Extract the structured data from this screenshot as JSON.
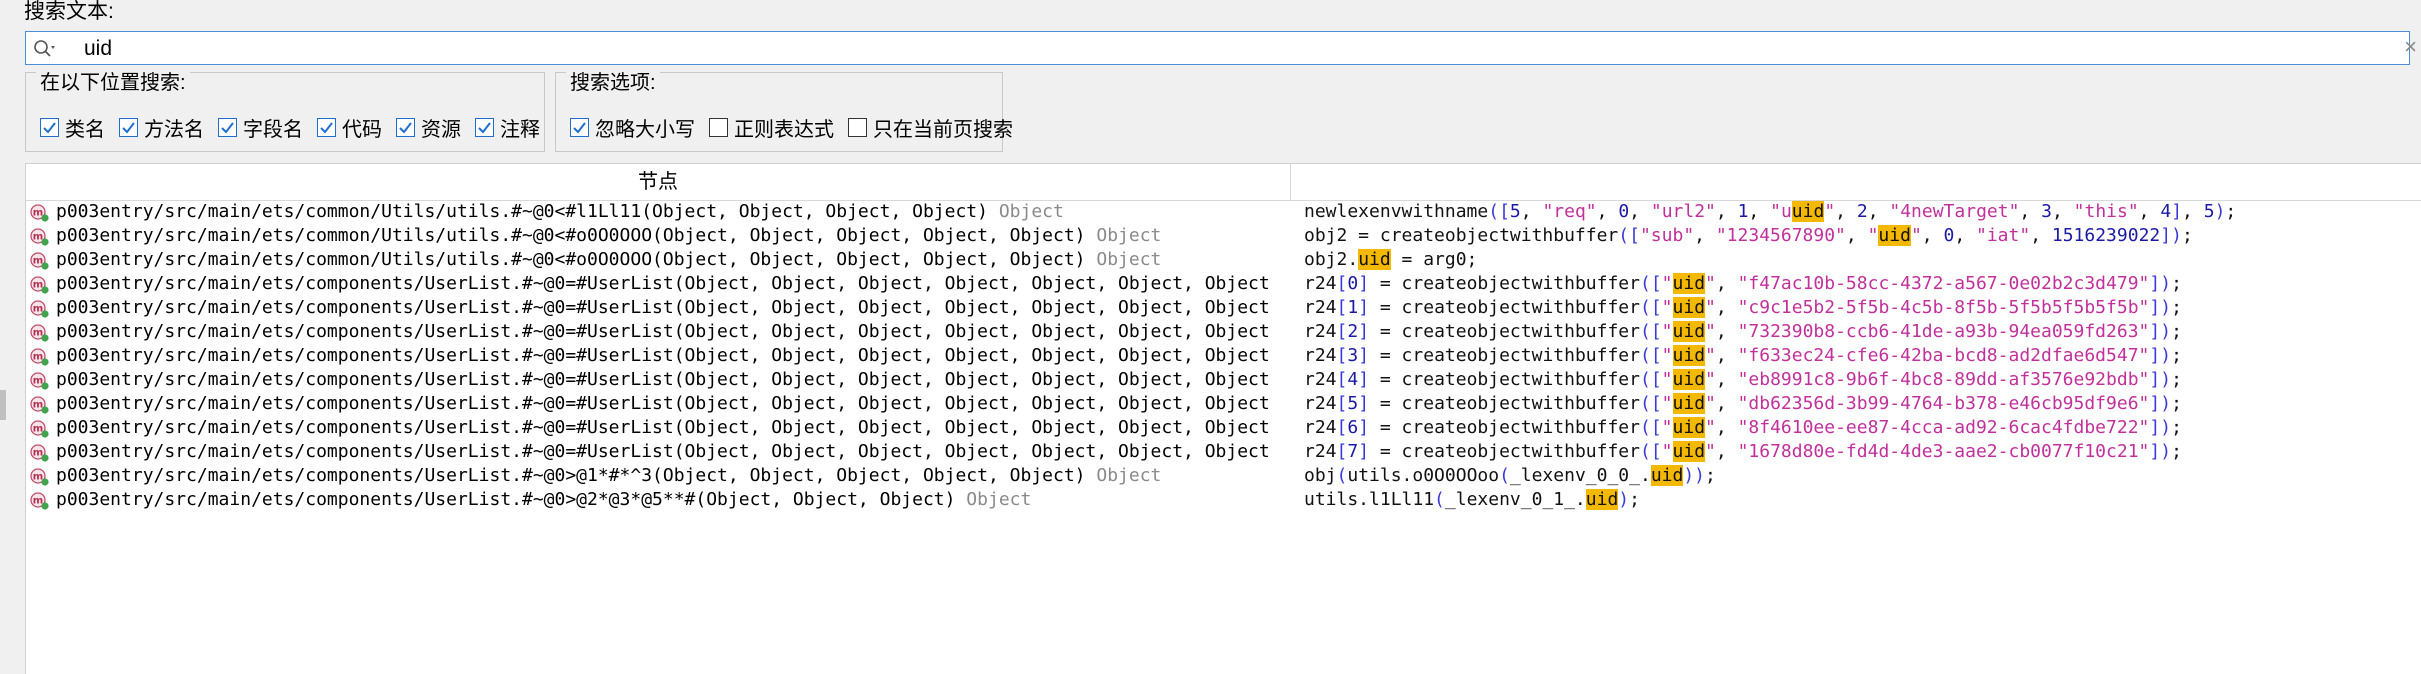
{
  "search_label": "搜索文本:",
  "search": {
    "value": "uid",
    "placeholder": ""
  },
  "location_group": {
    "legend": "在以下位置搜索:",
    "options": [
      {
        "label": "类名",
        "checked": true
      },
      {
        "label": "方法名",
        "checked": true
      },
      {
        "label": "字段名",
        "checked": true
      },
      {
        "label": "代码",
        "checked": true
      },
      {
        "label": "资源",
        "checked": true
      },
      {
        "label": "注释",
        "checked": true
      }
    ]
  },
  "options_group": {
    "legend": "搜索选项:",
    "options": [
      {
        "label": "忽略大小写",
        "checked": true
      },
      {
        "label": "正则表达式",
        "checked": false
      },
      {
        "label": "只在当前页搜索",
        "checked": false
      }
    ]
  },
  "table": {
    "header_node": "节点",
    "rows": [
      {
        "node": "p003entry/src/main/ets/common/Utils/utils.#~@0<#l1Ll11(Object, Object, Object, Object)",
        "type": "Object",
        "code": [
          [
            "t",
            "newlexenvwithname"
          ],
          [
            "b",
            "(["
          ],
          [
            "n",
            "5"
          ],
          [
            "t",
            ", "
          ],
          [
            "s",
            "\"req\""
          ],
          [
            "t",
            ", "
          ],
          [
            "n",
            "0"
          ],
          [
            "t",
            ", "
          ],
          [
            "s",
            "\"url2\""
          ],
          [
            "t",
            ", "
          ],
          [
            "n",
            "1"
          ],
          [
            "t",
            ", "
          ],
          [
            "s",
            "\"u"
          ],
          [
            "h",
            "uid"
          ],
          [
            "s",
            "\""
          ],
          [
            "t",
            ", "
          ],
          [
            "n",
            "2"
          ],
          [
            "t",
            ", "
          ],
          [
            "s",
            "\"4newTarget\""
          ],
          [
            "t",
            ", "
          ],
          [
            "n",
            "3"
          ],
          [
            "t",
            ", "
          ],
          [
            "s",
            "\"this\""
          ],
          [
            "t",
            ", "
          ],
          [
            "n",
            "4"
          ],
          [
            "b",
            "]"
          ],
          [
            "t",
            ", "
          ],
          [
            "n",
            "5"
          ],
          [
            "b",
            ")"
          ],
          [
            "t",
            ";"
          ]
        ]
      },
      {
        "node": "p003entry/src/main/ets/common/Utils/utils.#~@0<#o0O0OOO(Object, Object, Object, Object, Object)",
        "type": "Object",
        "code": [
          [
            "t",
            "obj2 = createobjectwithbuffer"
          ],
          [
            "b",
            "(["
          ],
          [
            "s",
            "\"sub\""
          ],
          [
            "t",
            ", "
          ],
          [
            "s",
            "\"1234567890\""
          ],
          [
            "t",
            ", "
          ],
          [
            "s",
            "\""
          ],
          [
            "h",
            "uid"
          ],
          [
            "s",
            "\""
          ],
          [
            "t",
            ", "
          ],
          [
            "n",
            "0"
          ],
          [
            "t",
            ", "
          ],
          [
            "s",
            "\"iat\""
          ],
          [
            "t",
            ", "
          ],
          [
            "n",
            "1516239022"
          ],
          [
            "b",
            "])"
          ],
          [
            "t",
            ";"
          ]
        ]
      },
      {
        "node": "p003entry/src/main/ets/common/Utils/utils.#~@0<#o0O0OOO(Object, Object, Object, Object, Object)",
        "type": "Object",
        "code": [
          [
            "t",
            "obj2."
          ],
          [
            "h",
            "uid"
          ],
          [
            "t",
            " = arg0;"
          ]
        ]
      },
      {
        "node": "p003entry/src/main/ets/components/UserList.#~@0=#UserList(Object, Object, Object, Object, Object, Object, Object",
        "type": "",
        "code": [
          [
            "t",
            "r24"
          ],
          [
            "b",
            "["
          ],
          [
            "n",
            "0"
          ],
          [
            "b",
            "]"
          ],
          [
            "t",
            " = createobjectwithbuffer"
          ],
          [
            "b",
            "(["
          ],
          [
            "s",
            "\""
          ],
          [
            "h",
            "uid"
          ],
          [
            "s",
            "\""
          ],
          [
            "t",
            ", "
          ],
          [
            "s",
            "\"f47ac10b-58cc-4372-a567-0e02b2c3d479\""
          ],
          [
            "b",
            "])"
          ],
          [
            "t",
            ";"
          ]
        ]
      },
      {
        "node": "p003entry/src/main/ets/components/UserList.#~@0=#UserList(Object, Object, Object, Object, Object, Object, Object",
        "type": "",
        "code": [
          [
            "t",
            "r24"
          ],
          [
            "b",
            "["
          ],
          [
            "n",
            "1"
          ],
          [
            "b",
            "]"
          ],
          [
            "t",
            " = createobjectwithbuffer"
          ],
          [
            "b",
            "(["
          ],
          [
            "s",
            "\""
          ],
          [
            "h",
            "uid"
          ],
          [
            "s",
            "\""
          ],
          [
            "t",
            ", "
          ],
          [
            "s",
            "\"c9c1e5b2-5f5b-4c5b-8f5b-5f5b5f5b5f5b\""
          ],
          [
            "b",
            "])"
          ],
          [
            "t",
            ";"
          ]
        ]
      },
      {
        "node": "p003entry/src/main/ets/components/UserList.#~@0=#UserList(Object, Object, Object, Object, Object, Object, Object",
        "type": "",
        "code": [
          [
            "t",
            "r24"
          ],
          [
            "b",
            "["
          ],
          [
            "n",
            "2"
          ],
          [
            "b",
            "]"
          ],
          [
            "t",
            " = createobjectwithbuffer"
          ],
          [
            "b",
            "(["
          ],
          [
            "s",
            "\""
          ],
          [
            "h",
            "uid"
          ],
          [
            "s",
            "\""
          ],
          [
            "t",
            ", "
          ],
          [
            "s",
            "\"732390b8-ccb6-41de-a93b-94ea059fd263\""
          ],
          [
            "b",
            "])"
          ],
          [
            "t",
            ";"
          ]
        ]
      },
      {
        "node": "p003entry/src/main/ets/components/UserList.#~@0=#UserList(Object, Object, Object, Object, Object, Object, Object",
        "type": "",
        "code": [
          [
            "t",
            "r24"
          ],
          [
            "b",
            "["
          ],
          [
            "n",
            "3"
          ],
          [
            "b",
            "]"
          ],
          [
            "t",
            " = createobjectwithbuffer"
          ],
          [
            "b",
            "(["
          ],
          [
            "s",
            "\""
          ],
          [
            "h",
            "uid"
          ],
          [
            "s",
            "\""
          ],
          [
            "t",
            ", "
          ],
          [
            "s",
            "\"f633ec24-cfe6-42ba-bcd8-ad2dfae6d547\""
          ],
          [
            "b",
            "])"
          ],
          [
            "t",
            ";"
          ]
        ]
      },
      {
        "node": "p003entry/src/main/ets/components/UserList.#~@0=#UserList(Object, Object, Object, Object, Object, Object, Object",
        "type": "",
        "code": [
          [
            "t",
            "r24"
          ],
          [
            "b",
            "["
          ],
          [
            "n",
            "4"
          ],
          [
            "b",
            "]"
          ],
          [
            "t",
            " = createobjectwithbuffer"
          ],
          [
            "b",
            "(["
          ],
          [
            "s",
            "\""
          ],
          [
            "h",
            "uid"
          ],
          [
            "s",
            "\""
          ],
          [
            "t",
            ", "
          ],
          [
            "s",
            "\"eb8991c8-9b6f-4bc8-89dd-af3576e92bdb\""
          ],
          [
            "b",
            "])"
          ],
          [
            "t",
            ";"
          ]
        ]
      },
      {
        "node": "p003entry/src/main/ets/components/UserList.#~@0=#UserList(Object, Object, Object, Object, Object, Object, Object",
        "type": "",
        "code": [
          [
            "t",
            "r24"
          ],
          [
            "b",
            "["
          ],
          [
            "n",
            "5"
          ],
          [
            "b",
            "]"
          ],
          [
            "t",
            " = createobjectwithbuffer"
          ],
          [
            "b",
            "(["
          ],
          [
            "s",
            "\""
          ],
          [
            "h",
            "uid"
          ],
          [
            "s",
            "\""
          ],
          [
            "t",
            ", "
          ],
          [
            "s",
            "\"db62356d-3b99-4764-b378-e46cb95df9e6\""
          ],
          [
            "b",
            "])"
          ],
          [
            "t",
            ";"
          ]
        ]
      },
      {
        "node": "p003entry/src/main/ets/components/UserList.#~@0=#UserList(Object, Object, Object, Object, Object, Object, Object",
        "type": "",
        "code": [
          [
            "t",
            "r24"
          ],
          [
            "b",
            "["
          ],
          [
            "n",
            "6"
          ],
          [
            "b",
            "]"
          ],
          [
            "t",
            " = createobjectwithbuffer"
          ],
          [
            "b",
            "(["
          ],
          [
            "s",
            "\""
          ],
          [
            "h",
            "uid"
          ],
          [
            "s",
            "\""
          ],
          [
            "t",
            ", "
          ],
          [
            "s",
            "\"8f4610ee-ee87-4cca-ad92-6cac4fdbe722\""
          ],
          [
            "b",
            "])"
          ],
          [
            "t",
            ";"
          ]
        ]
      },
      {
        "node": "p003entry/src/main/ets/components/UserList.#~@0=#UserList(Object, Object, Object, Object, Object, Object, Object",
        "type": "",
        "code": [
          [
            "t",
            "r24"
          ],
          [
            "b",
            "["
          ],
          [
            "n",
            "7"
          ],
          [
            "b",
            "]"
          ],
          [
            "t",
            " = createobjectwithbuffer"
          ],
          [
            "b",
            "(["
          ],
          [
            "s",
            "\""
          ],
          [
            "h",
            "uid"
          ],
          [
            "s",
            "\""
          ],
          [
            "t",
            ", "
          ],
          [
            "s",
            "\"1678d80e-fd4d-4de3-aae2-cb0077f10c21\""
          ],
          [
            "b",
            "])"
          ],
          [
            "t",
            ";"
          ]
        ]
      },
      {
        "node": "p003entry/src/main/ets/components/UserList.#~@0>@1*#*^3(Object, Object, Object, Object, Object)",
        "type": "Object",
        "code": [
          [
            "t",
            "obj"
          ],
          [
            "b",
            "("
          ],
          [
            "t",
            "utils.o0O0OOoo"
          ],
          [
            "b",
            "("
          ],
          [
            "t",
            "_lexenv_0_0_."
          ],
          [
            "h",
            "uid"
          ],
          [
            "b",
            "))"
          ],
          [
            "t",
            ";"
          ]
        ]
      },
      {
        "node": "p003entry/src/main/ets/components/UserList.#~@0>@2*@3*@5**#(Object, Object, Object)",
        "type": "Object",
        "code": [
          [
            "t",
            "utils.l1Ll11"
          ],
          [
            "b",
            "("
          ],
          [
            "t",
            "_lexenv_0_1_."
          ],
          [
            "h",
            "uid"
          ],
          [
            "b",
            ")"
          ],
          [
            "t",
            ";"
          ]
        ]
      }
    ]
  }
}
